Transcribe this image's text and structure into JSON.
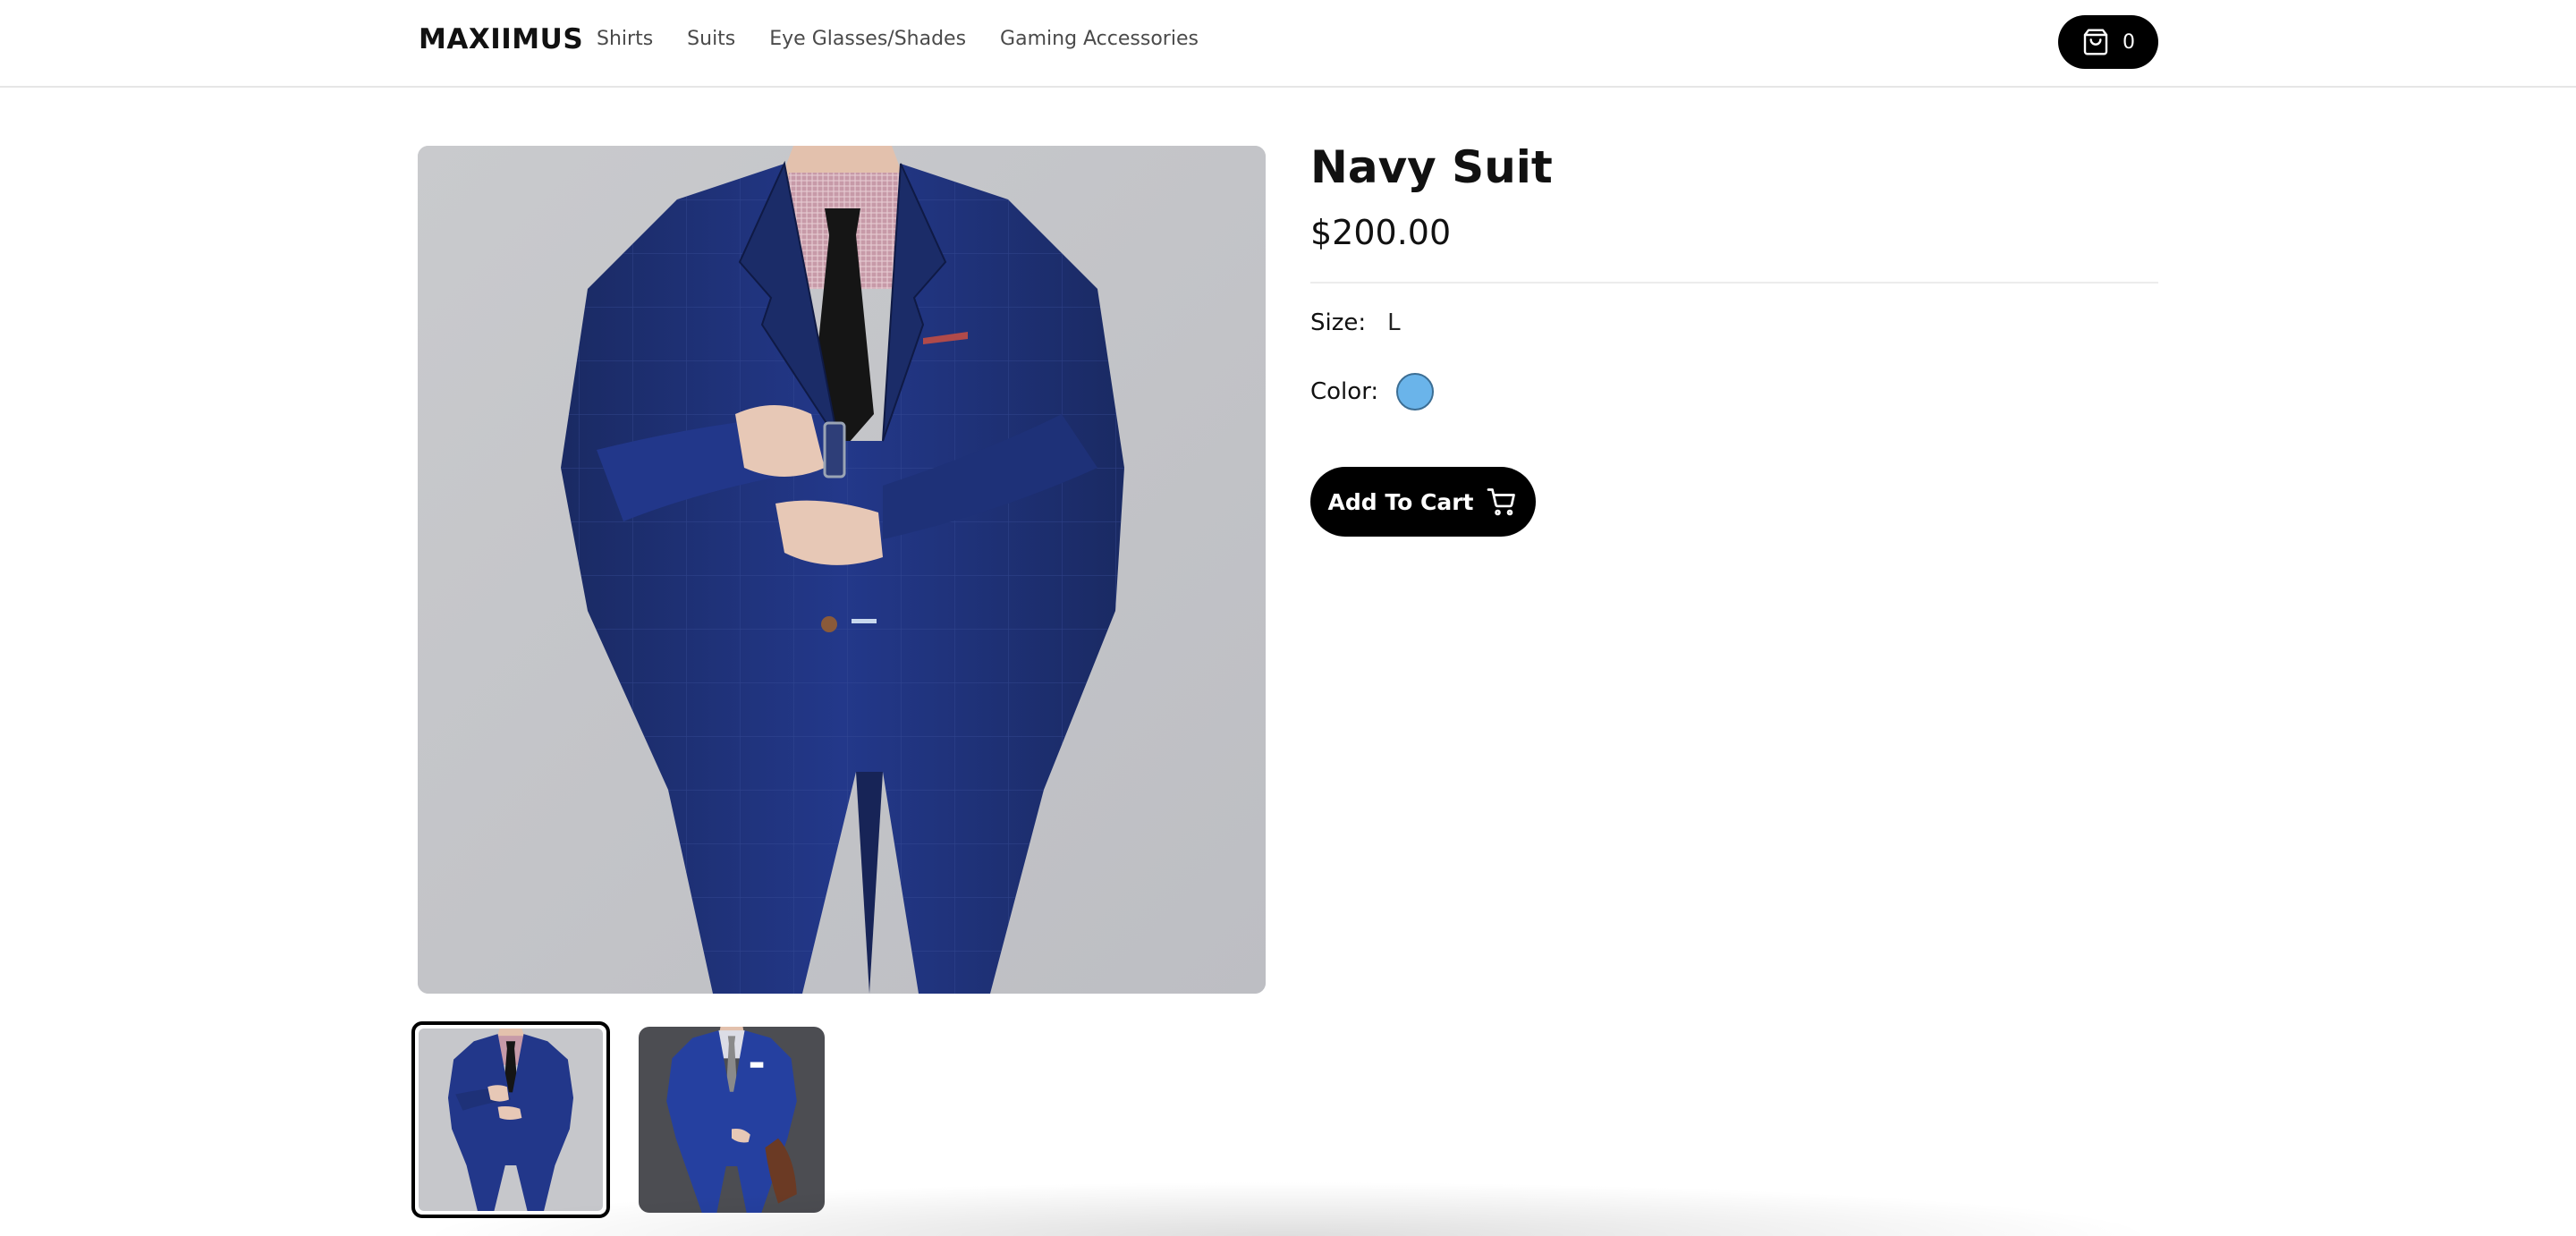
{
  "header": {
    "logo": "MAXIIMUS",
    "nav": [
      {
        "label": "Shirts"
      },
      {
        "label": "Suits"
      },
      {
        "label": "Eye Glasses/Shades"
      },
      {
        "label": "Gaming Accessories"
      }
    ],
    "cart": {
      "icon": "shopping-bag-icon",
      "count": "0"
    }
  },
  "product": {
    "title": "Navy Suit",
    "price": "$200.00",
    "size": {
      "label": "Size:",
      "value": "L"
    },
    "color": {
      "label": "Color:",
      "swatch": "#6ab4ea"
    },
    "add_to_cart": {
      "label": "Add To Cart",
      "icon": "cart-icon"
    }
  },
  "gallery": {
    "thumbnails": [
      {
        "selected": true
      },
      {
        "selected": false
      }
    ]
  },
  "colors": {
    "accent": "#000000",
    "suit": "#1e3270",
    "background_photo": "#c7c8cc"
  }
}
